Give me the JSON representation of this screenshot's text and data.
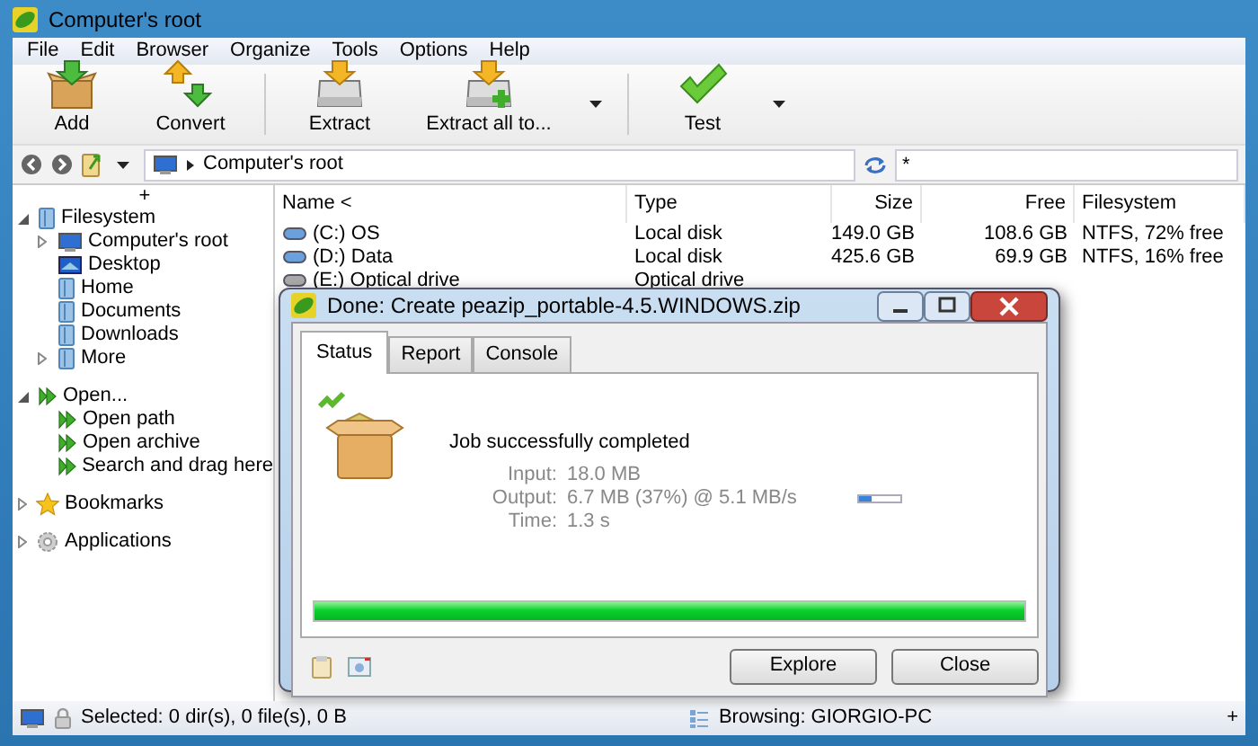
{
  "window": {
    "title": "Computer's root"
  },
  "menu": [
    "File",
    "Edit",
    "Browser",
    "Organize",
    "Tools",
    "Options",
    "Help"
  ],
  "toolbar": [
    {
      "kind": "button",
      "label": "Add"
    },
    {
      "kind": "button",
      "label": "Convert"
    },
    {
      "kind": "separator"
    },
    {
      "kind": "button",
      "label": "Extract"
    },
    {
      "kind": "button",
      "label": "Extract all to..."
    },
    {
      "kind": "dropdown"
    },
    {
      "kind": "separator"
    },
    {
      "kind": "button",
      "label": "Test"
    },
    {
      "kind": "dropdown"
    }
  ],
  "address": {
    "path": "Computer's root",
    "search": "*"
  },
  "sidebar": {
    "corner": "+",
    "sections": [
      {
        "label": "Filesystem",
        "expanded": true,
        "children": [
          {
            "label": "Computer's root",
            "expandable": true
          },
          {
            "label": "Desktop",
            "expandable": false
          },
          {
            "label": "Home",
            "expandable": false
          },
          {
            "label": "Documents",
            "expandable": false
          },
          {
            "label": "Downloads",
            "expandable": false
          },
          {
            "label": "More",
            "expandable": true
          }
        ]
      },
      {
        "label": "Open...",
        "expanded": true,
        "children": [
          {
            "label": "Open path",
            "expandable": false
          },
          {
            "label": "Open archive",
            "expandable": false
          },
          {
            "label": "Search and drag here",
            "expandable": false
          }
        ]
      },
      {
        "label": "Bookmarks",
        "expanded": false
      },
      {
        "label": "Applications",
        "expanded": false
      }
    ]
  },
  "table": {
    "columns": [
      "Name <",
      "Type",
      "Size",
      "Free",
      "Filesystem"
    ],
    "rows": [
      {
        "name": "(C:) OS",
        "type": "Local disk",
        "size": "149.0 GB",
        "free": "108.6 GB",
        "filesystem": "NTFS, 72% free"
      },
      {
        "name": "(D:) Data",
        "type": "Local disk",
        "size": "425.6 GB",
        "free": "69.9 GB",
        "filesystem": "NTFS, 16% free"
      },
      {
        "name": "(E:) Optical drive",
        "type": "Optical drive"
      }
    ]
  },
  "dialog": {
    "title": "Done: Create peazip_portable-4.5.WINDOWS.zip",
    "tabs": [
      {
        "label": "Status",
        "selected": true
      },
      {
        "label": "Report",
        "selected": false
      },
      {
        "label": "Console",
        "selected": false
      }
    ],
    "message": "Job successfully completed",
    "stats": [
      {
        "label": "Input:",
        "value": "18.0 MB"
      },
      {
        "label": "Output:",
        "value": "6.7 MB (37%) @ 5.1 MB/s",
        "level": 0.3
      },
      {
        "label": "Time:",
        "value": "1.3 s"
      }
    ],
    "progress": {
      "level": 1.0
    },
    "buttons": [
      "Explore",
      "Close"
    ]
  },
  "status_bar": {
    "selected": "Selected: 0 dir(s), 0 file(s), 0 B",
    "browsing": "Browsing: GIORGIO-PC",
    "corner": "+"
  }
}
